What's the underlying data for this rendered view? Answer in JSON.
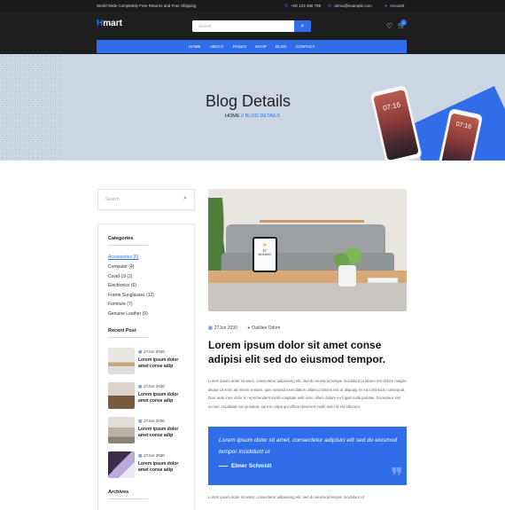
{
  "topbar": {
    "promo": "World Wide Completely Free Returns and Free Shipping",
    "phone": "+00 123 456 789",
    "email": "demo@example.com",
    "account": "Account"
  },
  "header": {
    "logo_accent": "H",
    "logo_rest": "mart",
    "search_placeholder": "Search",
    "cart_count": "0"
  },
  "nav": {
    "items": [
      "HOME",
      "ABOUT",
      "PAGES",
      "SHOP",
      "BLOG",
      "CONTACT"
    ]
  },
  "hero": {
    "title": "Blog Details",
    "breadcrumb_home": "HOME",
    "breadcrumb_sep": " // ",
    "breadcrumb_current": "BLOG DETAILS",
    "phone_time": "07:16"
  },
  "sidebar": {
    "search_placeholder": "Search",
    "categories_title": "Categories",
    "categories": [
      "Accessories (6)",
      "Computer (4)",
      "Covid-19 (2)",
      "Electronics (6)",
      "Frame Sunglasses (12)",
      "Furniture (7)",
      "Genuine Leather (9)"
    ],
    "recent_title": "Recent Post",
    "recent_posts": [
      {
        "date": "27Jun 2030",
        "title": "Lorem ipsum dolor amet conse adip"
      },
      {
        "date": "27Jun 2030",
        "title": "Lorem ipsum dolor amet conse adip"
      },
      {
        "date": "27Jun 2030",
        "title": "Lorem ipsum dolor amet conse adip"
      },
      {
        "date": "27Jun 2030",
        "title": "Lorem ipsum dolor amet conse adip"
      }
    ],
    "archives_title": "Archives"
  },
  "post": {
    "date": "27Jun 2030",
    "author": "Oakliee Odom",
    "tablet_temp": "32°",
    "tablet_day": "MONDAY",
    "title": "Lorem ipsum dolor sit amet conse adipisi elit sed do eiusmod tempor.",
    "paragraph": "Lorem ipsum dolor sit amet, consectetur adipisicing elit, sed do eiusmod tempor incididunt ut labore eto dolore magna aliqua Ut enim ad minim veniam, quis nostrud exercitation ullamco laboris nisi ut aliquipp ex ea commodo consequat. Duis aute irure dolor in reprehenderit inlolit voluptate velit esse cillum dolore eu fugiat nulla pariatur. Excepteur sint occaec cupidatat non proident, sunt in culpa qui officia deserunt mollit anim id est laborum.",
    "quote": "Lorem ipsum dolor sit amet, consectetur adipisici elit sed do eiusmod tempor incididunt ut",
    "quote_author": "Elmer Schmidt",
    "paragraph2": "Lorem ipsum dolor sit amet, consectetur adipisicing elit, sed do eiusmod tempor incididunt ut"
  },
  "colors": {
    "accent": "#2f6ee8",
    "topbar": "#1a1a1a",
    "header": "#1f1f1f",
    "hero_bg": "#ccd6e2"
  }
}
